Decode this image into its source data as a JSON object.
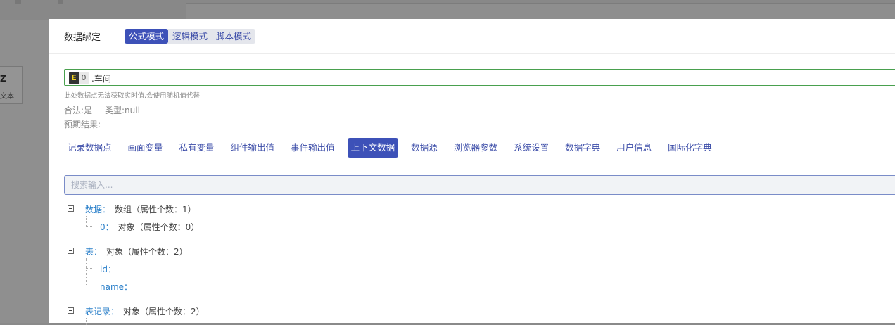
{
  "background": {
    "card_letter": "Z",
    "card_text": "文本"
  },
  "dialog": {
    "title": "数据绑定",
    "modes": [
      "公式模式",
      "逻辑模式",
      "脚本模式"
    ],
    "active_mode": "公式模式"
  },
  "formula": {
    "chip_letter": "E",
    "chip_index": "0",
    "text": ".车间"
  },
  "hint": "此处数据点无法获取实时值,会使用随机值代替",
  "legal": "合法:是",
  "type": "类型:null",
  "expected": "预期结果:",
  "tabs": [
    "记录数据点",
    "画面变量",
    "私有变量",
    "组件输出值",
    "事件输出值",
    "上下文数据",
    "数据源",
    "浏览器参数",
    "系统设置",
    "数据字典",
    "用户信息",
    "国际化字典"
  ],
  "active_tab": "上下文数据",
  "search": {
    "placeholder": "搜索输入..."
  },
  "tree": {
    "n1": {
      "key": "数据：",
      "val": "数组（属性个数：1）"
    },
    "n1c1": {
      "key": "0：",
      "val": "对象（属性个数：0）"
    },
    "n2": {
      "key": "表：",
      "val": "对象（属性个数：2）"
    },
    "n2c1": {
      "key": "id：",
      "val": ""
    },
    "n2c2": {
      "key": "name：",
      "val": ""
    },
    "n3": {
      "key": "表记录：",
      "val": "对象（属性个数：2）"
    }
  },
  "colors": {
    "accent": "#3d51b8",
    "link": "#3b4ca8",
    "tree_key": "#2a7fc9",
    "valid_border": "#49a04e",
    "chip_bg": "#333333",
    "chip_fg": "#f2d321"
  }
}
